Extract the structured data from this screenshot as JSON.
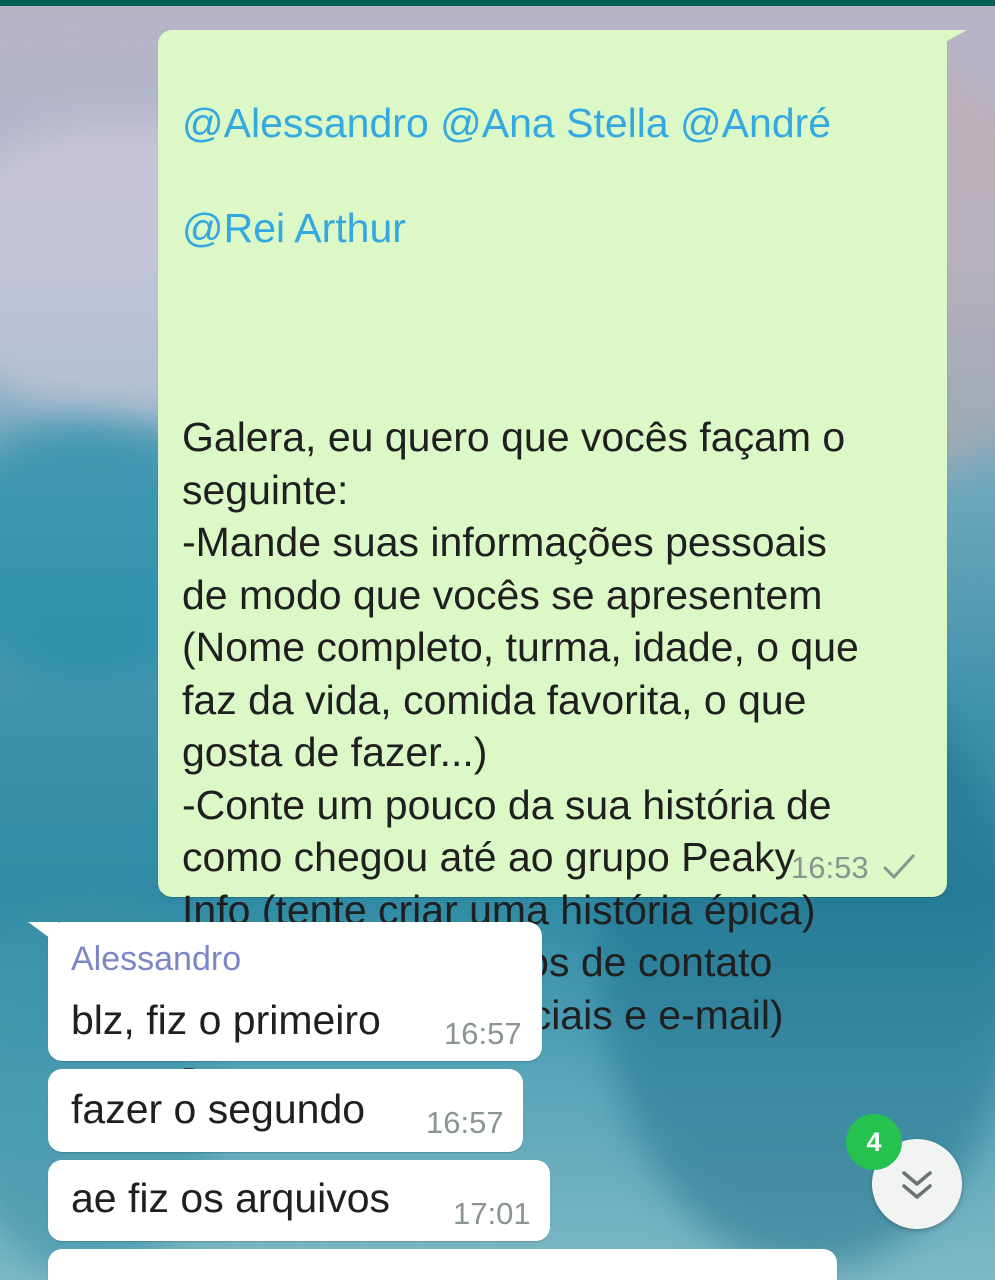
{
  "colors": {
    "outgoing_bubble": "#dcf8c6",
    "incoming_bubble": "#ffffff",
    "mention": "#34a8e0",
    "sender_name": "#7b86c8",
    "unread_badge": "#25c24f",
    "header_strip": "#075e54"
  },
  "outgoing_message": {
    "mentions": [
      "@Alessandro @Ana Stella @André",
      "@Rei Arthur"
    ],
    "body": "Galera, eu quero que vocês façam o\nseguinte:\n-Mande suas informações pessoais\nde modo que vocês se apresentem\n(Nome completo, turma, idade, o que\nfaz da vida, comida favorita, o que\ngosta de fazer...)\n-Conte um pouco da sua história de\ncomo chegou até ao grupo Peaky\nInfo (tente criar uma história épica)\n-Coloque seus dados de contato\n(Telefone, redes sociais e e-mail)\n-",
    "time": "16:53",
    "status_icon": "single-check-icon"
  },
  "incoming_messages": [
    {
      "sender": "Alessandro",
      "text": "blz, fiz o primeiro",
      "time": "16:57"
    },
    {
      "text": "fazer o segundo",
      "time": "16:57"
    },
    {
      "text": "ae fiz os arquivos",
      "time": "17:01"
    }
  ],
  "scroll_button": {
    "icon": "double-chevron-down-icon",
    "unread_count": "4"
  }
}
